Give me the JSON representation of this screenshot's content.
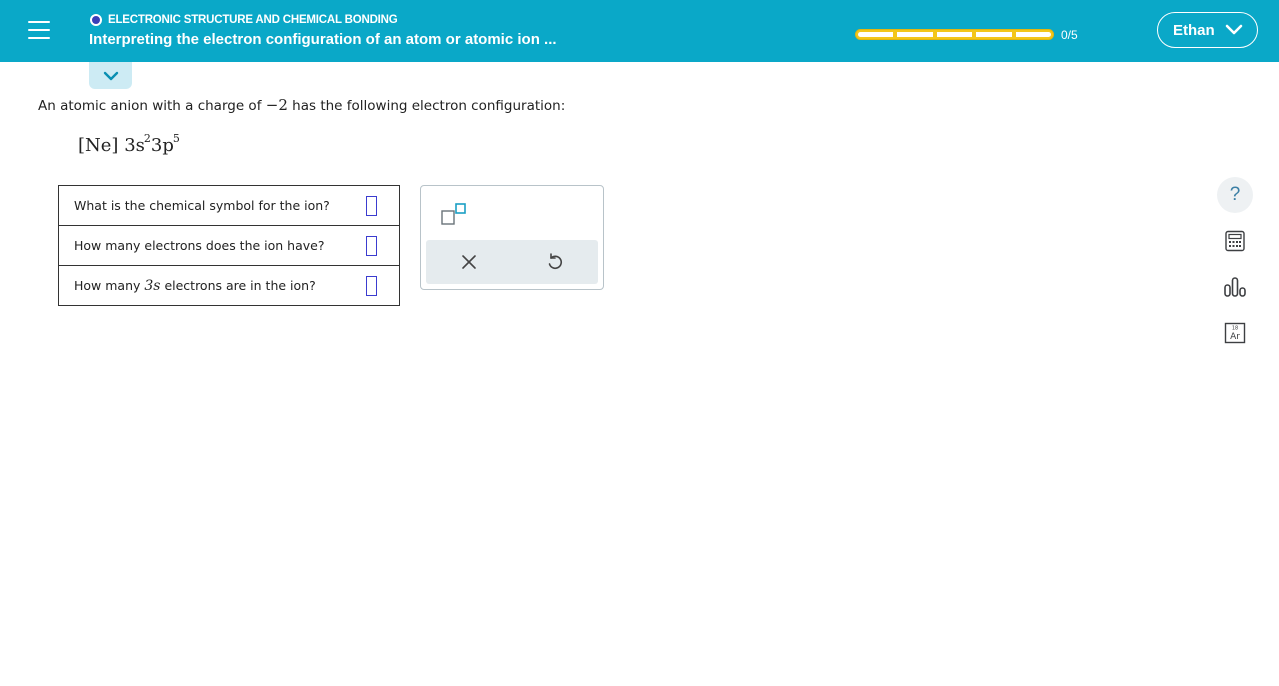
{
  "header": {
    "topic": "ELECTRONIC STRUCTURE AND CHEMICAL BONDING",
    "title": "Interpreting the electron configuration of an atom or atomic ion ...",
    "progress_value": 0,
    "progress_total": 5,
    "progress_text": "0/5",
    "user_name": "Ethan",
    "colors": {
      "bar": "#0aa8c8",
      "topic_dot": "#3a3fb8",
      "progress": "#f3c61b"
    }
  },
  "question": {
    "prompt_before": "An atomic anion with a charge of ",
    "charge": "−2",
    "prompt_after": " has the following electron configuration:",
    "config": {
      "core": "[Ne]",
      "orbital1": "3s",
      "orbital1_electrons": "2",
      "orbital2": "3p",
      "orbital2_electrons": "5"
    },
    "rows": [
      {
        "text": "What is the chemical symbol for the ion?",
        "answer": ""
      },
      {
        "text": "How many electrons does the ion have?",
        "answer": ""
      },
      {
        "before": "How many ",
        "orbital": "3s",
        "after": " electrons are in the ion?",
        "answer": ""
      }
    ]
  },
  "tools": {
    "superscript_icon": "superscript-box-icon",
    "clear_icon": "x-icon",
    "undo_icon": "undo-icon"
  },
  "side_tools": {
    "help_glyph": "?",
    "calculator_icon": "calculator-icon",
    "data_icon": "bar-chart-icon",
    "periodic_table_icon": "periodic-table-icon",
    "periodic_table_symbol": "Ar",
    "periodic_table_number": "18"
  }
}
